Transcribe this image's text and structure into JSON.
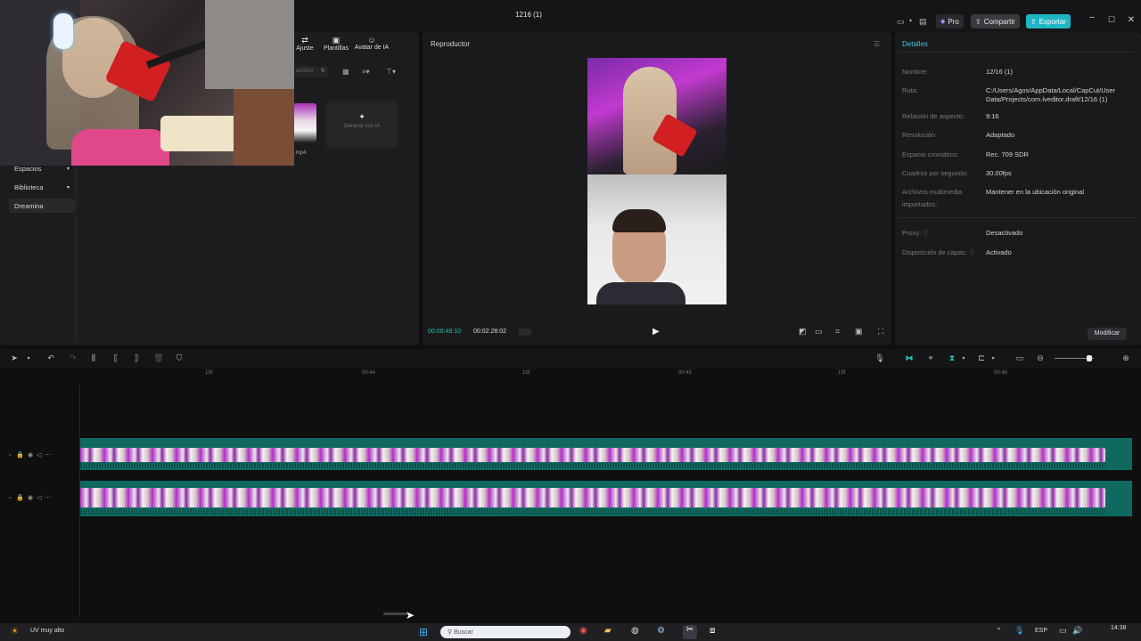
{
  "window": {
    "title": "1216 (1)",
    "pro_label": "Pro",
    "share_label": "Compartir",
    "export_label": "Exportar",
    "colors": {
      "accent": "#1fb6c4",
      "track": "#0f6960",
      "timecode": "#21c4b6"
    }
  },
  "media": {
    "tabs": [
      {
        "label": "Ajuste",
        "icon": "sliders-icon"
      },
      {
        "label": "Plantillas",
        "icon": "templates-icon"
      },
      {
        "label": "Avatar de IA",
        "icon": "avatar-icon"
      }
    ],
    "search_placeholder": "archivo",
    "file_name": ".mp4",
    "generate_label": "Generar con IA",
    "sidebar": [
      {
        "label": "Espacios"
      },
      {
        "label": "Biblioteca"
      },
      {
        "label": "Dreamina"
      }
    ]
  },
  "player": {
    "title": "Reproductor",
    "current_time": "00:00:49:10",
    "total_time": "00:02:28:02"
  },
  "details": {
    "title": "Detalles",
    "rows": [
      {
        "label": "Nombre:",
        "value": "12/16 (1)"
      },
      {
        "label": "Ruta:",
        "value": "C:/Users/Agos/AppData/Local/CapCut/User Data/Projects/com.lveditor.draft/12/16 (1)"
      },
      {
        "label": "Relación de aspecto:",
        "value": "9:16"
      },
      {
        "label": "Resolución:",
        "value": "Adaptado"
      },
      {
        "label": "Espacio cromático:",
        "value": "Rec. 709 SDR"
      },
      {
        "label": "Cuadros por segundo:",
        "value": "30.00fps"
      },
      {
        "label": "Archivos multimedia importados:",
        "value": "Mantener en la ubicación original"
      },
      {
        "label": "Proxy:",
        "value": "Desactivado"
      },
      {
        "label": "Disposición de capas:",
        "value": "Activado"
      }
    ],
    "modify_label": "Modificar"
  },
  "timeline": {
    "ticks": [
      "15f",
      "00:44",
      "15f",
      "00:45",
      "15f",
      "00:46"
    ],
    "zoom": 0.88
  },
  "taskbar": {
    "notification": "UV muy alto",
    "search_placeholder": "Buscar",
    "language": "ESP",
    "time": "14:38"
  }
}
